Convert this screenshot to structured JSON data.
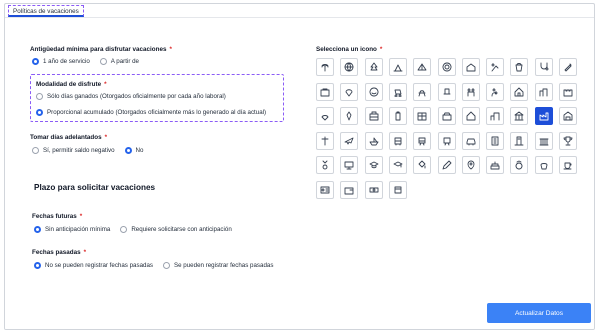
{
  "tab": {
    "label": "Políticas de vacaciones"
  },
  "min_seniority": {
    "label": "Antigüedad mínima para disfrutar vacaciones",
    "required_mark": "*",
    "options": [
      {
        "label": "1 año de servicio",
        "selected": true
      },
      {
        "label": "A partir de",
        "selected": false
      }
    ]
  },
  "enjoyment_mode": {
    "label": "Modalidad de disfrute",
    "required_mark": "*",
    "options": [
      {
        "label": "Sólo días ganados (Otorgados oficialmente por cada año laboral)",
        "selected": false
      },
      {
        "label": "Proporcional acumulado (Otorgados oficialmente más lo generado al día actual)",
        "selected": true
      }
    ]
  },
  "advance_days": {
    "label": "Tomar días adelantados",
    "required_mark": "*",
    "options": [
      {
        "label": "Sí, permitir saldo negativo",
        "selected": false
      },
      {
        "label": "No",
        "selected": true
      }
    ]
  },
  "request_deadline": {
    "heading": "Plazo para solicitar vacaciones"
  },
  "future_dates": {
    "label": "Fechas futuras",
    "required_mark": "*",
    "options": [
      {
        "label": "Sin anticipación mínima",
        "selected": true
      },
      {
        "label": "Requiere solicitarse con anticipación",
        "selected": false
      }
    ]
  },
  "past_dates": {
    "label": "Fechas pasadas",
    "required_mark": "*",
    "options": [
      {
        "label": "No se pueden registrar fechas pasadas",
        "selected": true
      },
      {
        "label": "Se pueden registrar fechas pasadas",
        "selected": false
      }
    ]
  },
  "icon_picker": {
    "label": "Selecciona un icono",
    "required_mark": "*",
    "selected_index": 31,
    "icons": [
      "palm-tree-icon",
      "globe-icon",
      "pine-tree-icon",
      "campfire-icon",
      "tent-icon",
      "life-ring-icon",
      "beach-house-icon",
      "snowboarder-icon",
      "beach-bucket-icon",
      "stethoscope-icon",
      "syringe-icon",
      "suitcase-icon",
      "heart-hand-icon",
      "smile-icon",
      "baby-stroller-icon",
      "rocking-horse-icon",
      "car-seat-icon",
      "family-icon",
      "mother-baby-icon",
      "house-icon",
      "city-icon",
      "castle-icon",
      "hands-heart-icon",
      "carrot-icon",
      "briefcase-icon",
      "luggage-icon",
      "cabinet-icon",
      "store-icon",
      "home-icon",
      "buildings-icon",
      "bank-icon",
      "factory-icon",
      "warehouse-icon",
      "cross-icon",
      "airplane-icon",
      "ship-icon",
      "bus-icon",
      "train-icon",
      "metro-icon",
      "car-icon",
      "apartment-icon",
      "skyscraper-icon",
      "library-icon",
      "trophy-icon",
      "medal-icon",
      "presentation-icon",
      "graduation-cap-icon",
      "mortarboard-icon",
      "paint-bucket-icon",
      "paintbrush-icon",
      "map-pin-icon",
      "cake-icon",
      "ring-icon",
      "hands-icon",
      "coffee-icon",
      "id-card-icon",
      "wallet-icon",
      "cash-icon",
      "card-icon"
    ]
  },
  "update_button": {
    "label": "Actualizar Datos"
  }
}
